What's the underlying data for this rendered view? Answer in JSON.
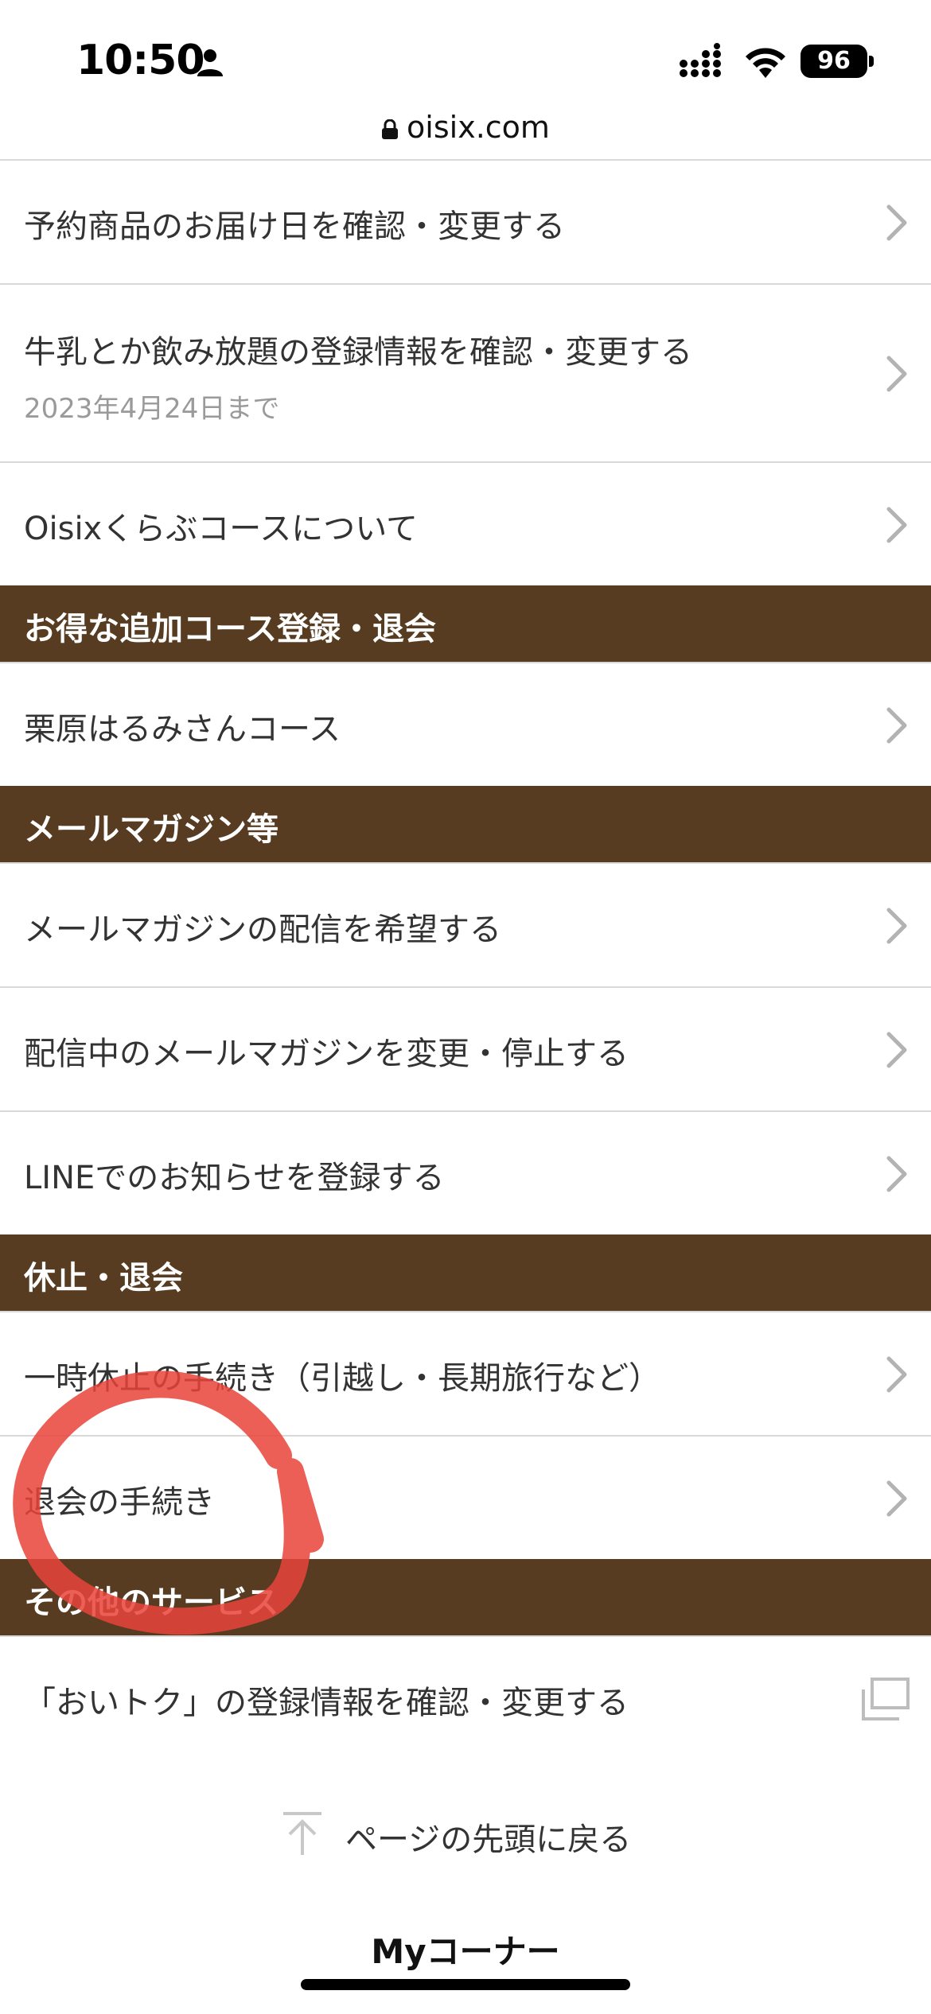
{
  "status_bar": {
    "time": "10:50",
    "battery": "96"
  },
  "browser": {
    "url": "oisix.com"
  },
  "list": [
    {
      "type": "item",
      "label": "予約商品のお届け日を確認・変更する",
      "sub": "",
      "icon": "chevron-right-icon"
    },
    {
      "type": "item",
      "label": "牛乳とか飲み放題の登録情報を確認・変更する",
      "sub": "2023年4月24日まで",
      "icon": "chevron-right-icon"
    },
    {
      "type": "item",
      "label": "Oisixくらぶコースについて",
      "sub": "",
      "icon": "chevron-right-icon"
    },
    {
      "type": "header",
      "label": "お得な追加コース登録・退会"
    },
    {
      "type": "item",
      "label": "栗原はるみさんコース",
      "sub": "",
      "icon": "chevron-right-icon"
    },
    {
      "type": "header",
      "label": "メールマガジン等"
    },
    {
      "type": "item",
      "label": "メールマガジンの配信を希望する",
      "sub": "",
      "icon": "chevron-right-icon"
    },
    {
      "type": "item",
      "label": "配信中のメールマガジンを変更・停止する",
      "sub": "",
      "icon": "chevron-right-icon"
    },
    {
      "type": "item",
      "label": "LINEでのお知らせを登録する",
      "sub": "",
      "icon": "chevron-right-icon"
    },
    {
      "type": "header",
      "label": "休止・退会"
    },
    {
      "type": "item",
      "label": "一時休止の手続き（引越し・長期旅行など）",
      "sub": "",
      "icon": "chevron-right-icon"
    },
    {
      "type": "item",
      "label": "退会の手続き",
      "sub": "",
      "icon": "chevron-right-icon"
    },
    {
      "type": "header",
      "label": "その他のサービス"
    },
    {
      "type": "item",
      "label": "「おいトク」の登録情報を確認・変更する",
      "sub": "",
      "icon": "external-window-icon"
    }
  ],
  "footer": {
    "back_to_top": "ページの先頭に戻る",
    "my_corner": "Myコーナー"
  },
  "colors": {
    "section_header_bg": "#573c22",
    "annotation": "#e8433a"
  }
}
